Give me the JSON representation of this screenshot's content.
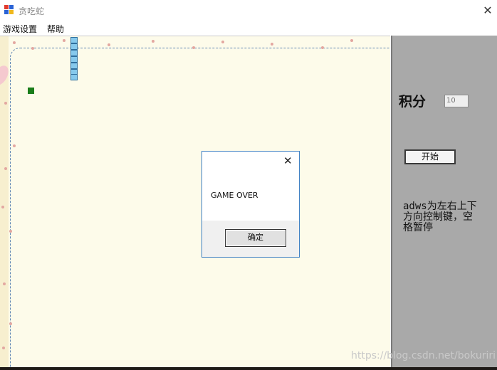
{
  "window": {
    "title": "贪吃蛇",
    "close_glyph": "✕"
  },
  "menu": {
    "items": [
      "游戏设置",
      "帮助"
    ]
  },
  "side_panel": {
    "score_label": "积分",
    "score_value": "10",
    "start_label": "开始",
    "help_text": "adws为左右上下方向控制键，空格暂停"
  },
  "dialog": {
    "message": "GAME OVER",
    "ok_label": "确定",
    "close_glyph": "✕"
  },
  "watermark": "https://blog.csdn.net/bokuriri",
  "icons": [
    "app-icon",
    "close-icon"
  ],
  "colors": {
    "snake": "#86c9ec",
    "food": "#1a7d1a",
    "panel": "#a9a9a9",
    "board": "#fdfbea",
    "dialog_border": "#3c7fc4"
  }
}
